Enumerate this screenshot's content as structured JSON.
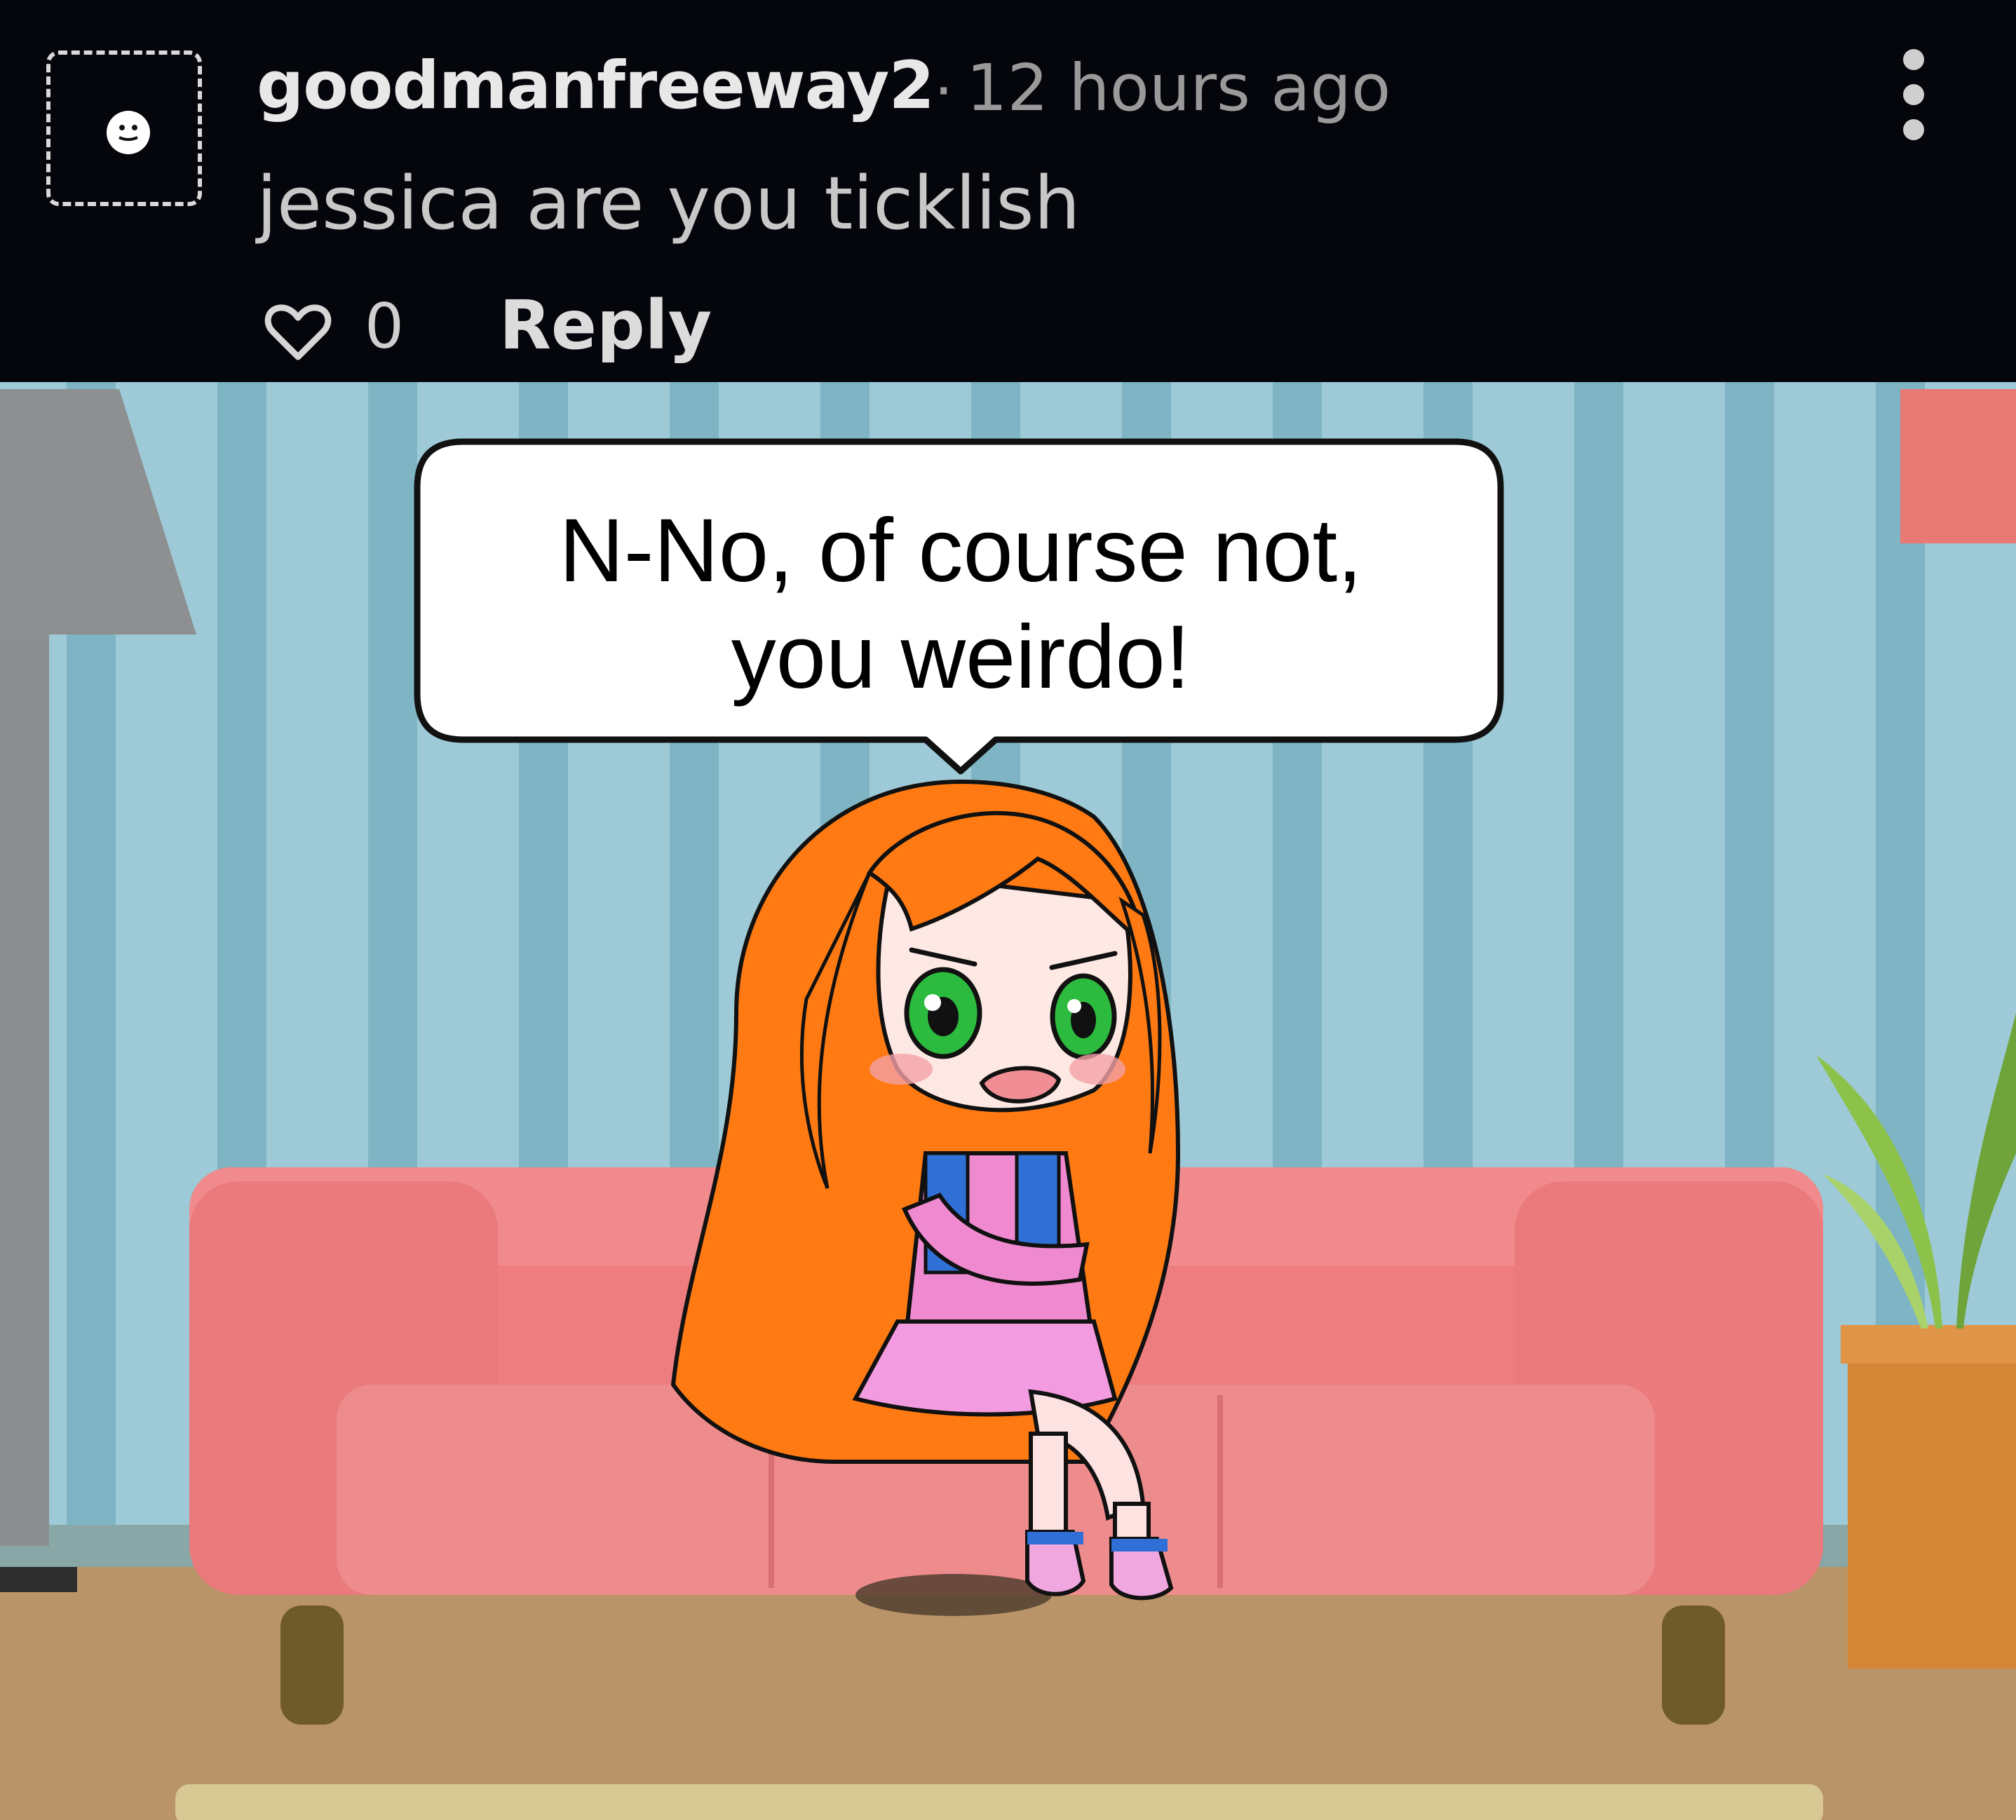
{
  "comment": {
    "username": "goodmanfreeway2",
    "separator": "·",
    "timestamp": "12 hours ago",
    "text": "jessica are you ticklish",
    "like_count": "0",
    "reply_label": "Reply",
    "icons": {
      "avatar": "smiley-avatar-icon",
      "like": "heart-outline-icon",
      "more": "more-vertical-icon"
    }
  },
  "image": {
    "speech_bubble": {
      "line1": "N-No, of course not,",
      "line2": "you weirdo!"
    }
  },
  "colors": {
    "background": "#05060b",
    "username": "#e8e8e8",
    "muted_text": "#9a9a9a",
    "wall_stripe_light": "#9dcad6",
    "wall_stripe_dark": "#7fb4c4",
    "sofa": "#ee7d80",
    "hair": "#ff7a12",
    "dress": "#f08ad0"
  }
}
